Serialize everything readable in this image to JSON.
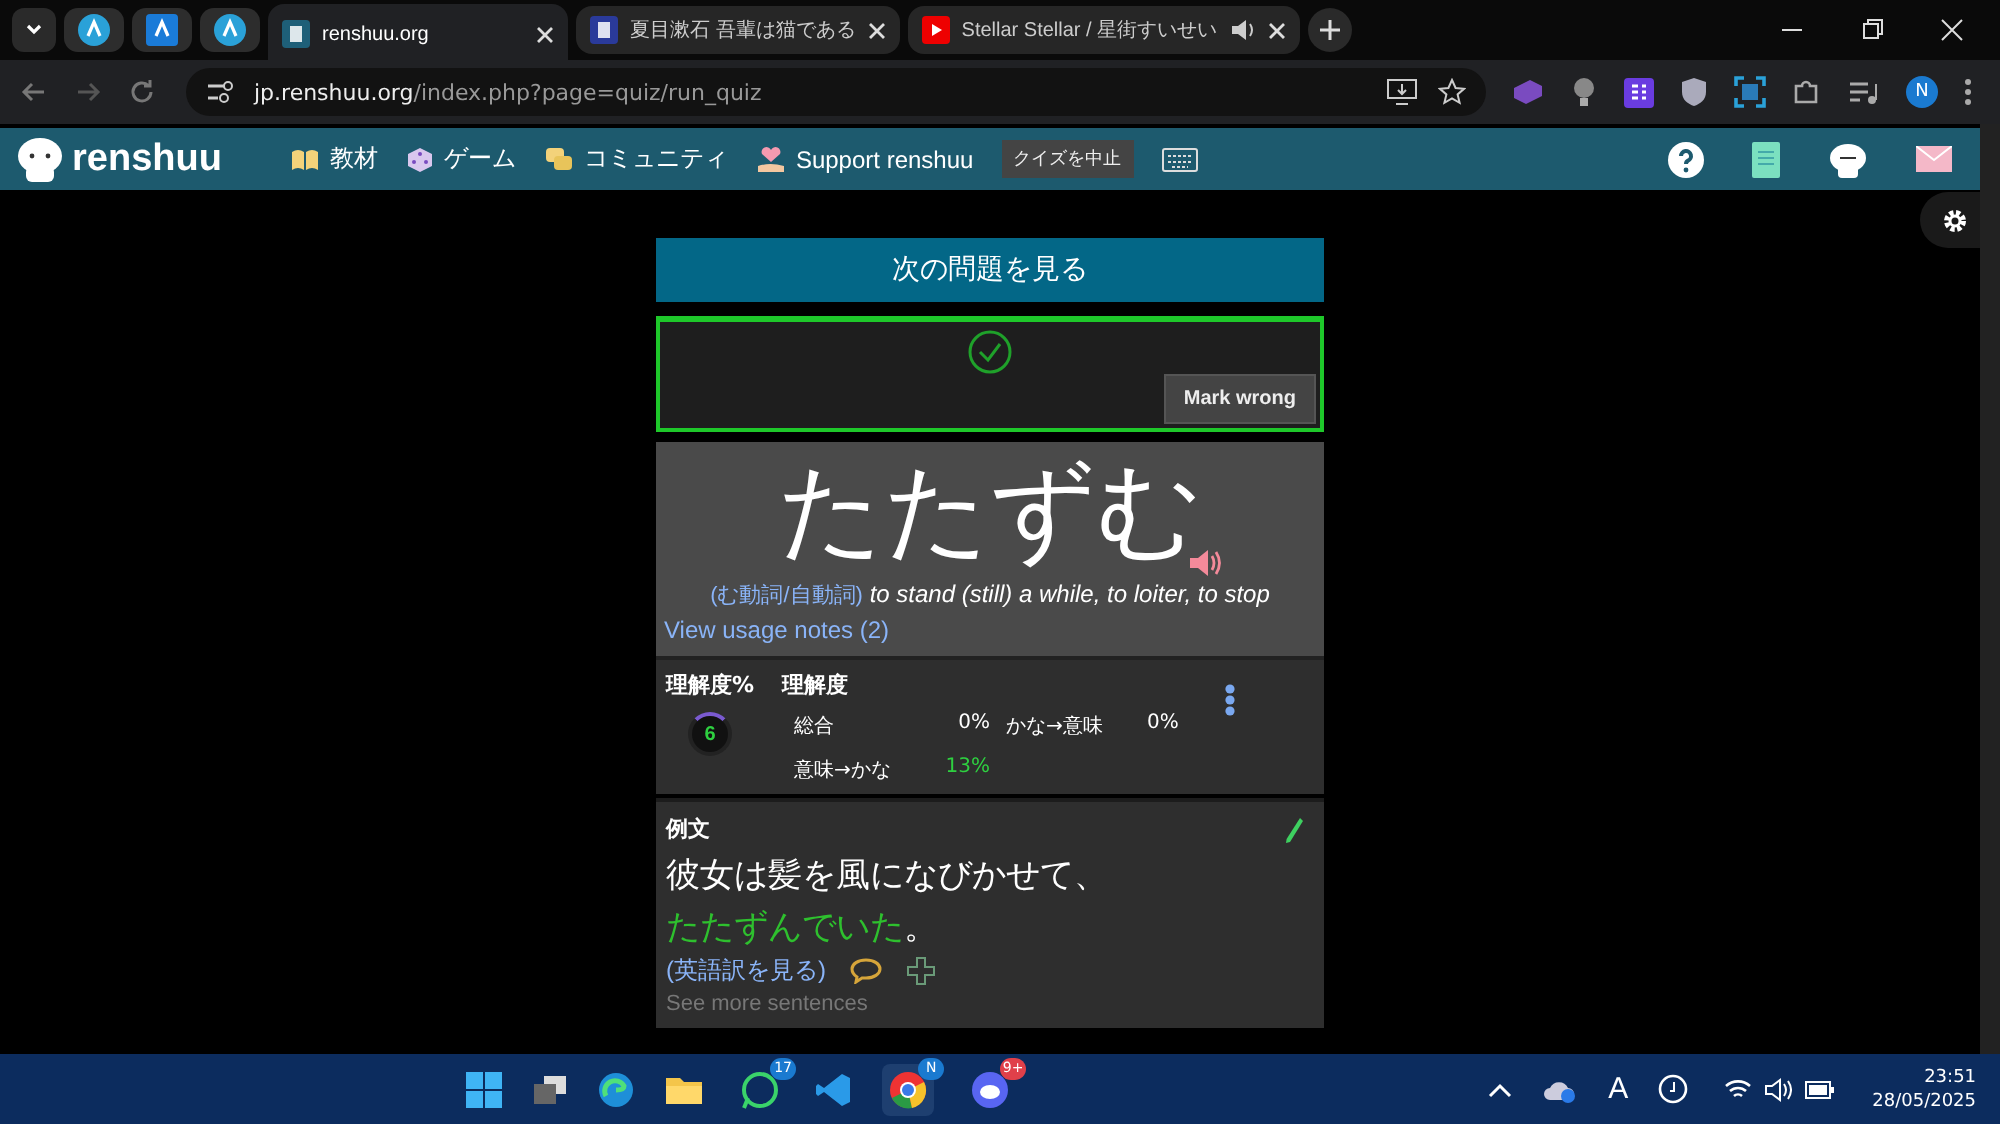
{
  "browser": {
    "tabs": [
      {
        "kind": "pinned"
      },
      {
        "kind": "pinned"
      },
      {
        "kind": "pinned"
      },
      {
        "kind": "page",
        "title": "renshuu.org",
        "selected": true
      },
      {
        "kind": "page",
        "title": "夏目漱石 吾輩は猫である",
        "selected": false
      },
      {
        "kind": "page",
        "title": "Stellar Stellar / 星街すいせい",
        "selected": false,
        "audio": true
      }
    ],
    "url_host": "jp.renshuu.org",
    "url_path": "/index.php?page=quiz/run_quiz",
    "profile_initial": "N"
  },
  "site_nav": {
    "logo": "renshuu",
    "items": [
      "教材",
      "ゲーム",
      "コミュニティ",
      "Support renshuu"
    ],
    "quit_button": "クイズを中止"
  },
  "quiz": {
    "next_button": "次の問題を見る",
    "correct": true,
    "mark_wrong_button": "Mark wrong",
    "word": "たたずむ",
    "word_types_label": "(む動詞/自動詞)",
    "meaning": "to stand (still) a while, to loiter, to stop",
    "usage_notes_link": "View usage notes (2)",
    "stats": {
      "percent_label": "理解度%",
      "level_label": "理解度",
      "gauge_value": "6",
      "rows": [
        {
          "label": "総合",
          "value": "0%",
          "highlight": false
        },
        {
          "label": "かな→意味",
          "value": "0%",
          "highlight": false
        },
        {
          "label": "意味→かな",
          "value": "13%",
          "highlight": true
        }
      ]
    },
    "example": {
      "title": "例文",
      "sentence_plain": "彼女は髪を風になびかせて、",
      "sentence_highlight": "たたずんでいた",
      "sentence_end": "。",
      "translate_link": "(英語訳を見る)",
      "more_link": "See more sentences"
    }
  },
  "taskbar": {
    "whatsapp_badge": "17",
    "discord_badge": "9+",
    "chrome_badge": "N",
    "input_indicator": "A",
    "time": "23:51",
    "date": "28/05/2025"
  }
}
